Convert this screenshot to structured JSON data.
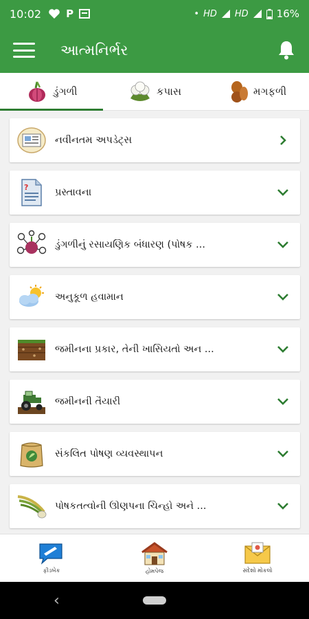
{
  "status_bar": {
    "time": "10:02",
    "signal_1": "HD",
    "signal_2": "HD",
    "battery": "16%"
  },
  "app_bar": {
    "title": "આત્મનિર્ભર"
  },
  "tabs": [
    {
      "label": "ડુંગળી",
      "icon": "onion-icon",
      "active": true
    },
    {
      "label": "કપાસ",
      "icon": "cotton-icon",
      "active": false
    },
    {
      "label": "મગફળી",
      "icon": "peanut-icon",
      "active": false
    }
  ],
  "list": [
    {
      "label": "નવીનતમ અપડેટ્સ",
      "icon": "newspaper-icon",
      "chevron": "right"
    },
    {
      "label": "પ્રસ્તાવના",
      "icon": "document-icon",
      "chevron": "down"
    },
    {
      "label": "ડુંગળીનું રસાયણિક બંધારણ (પોષક ...",
      "icon": "onion-nutrients-icon",
      "chevron": "down"
    },
    {
      "label": "અનુકૂળ હવામાન",
      "icon": "weather-icon",
      "chevron": "down"
    },
    {
      "label": "જમીનના પ્રકાર, તેની ખાસિયતો અન ...",
      "icon": "soil-icon",
      "chevron": "down"
    },
    {
      "label": "જમીનની તૈયારી",
      "icon": "tractor-icon",
      "chevron": "down"
    },
    {
      "label": "સંકલિત પોષણ વ્યવસ્થાપન",
      "icon": "fertilizer-bag-icon",
      "chevron": "down"
    },
    {
      "label": "પોષકતત્વોની ઊણપના ચિન્હો અને ...",
      "icon": "onion-leaves-icon",
      "chevron": "down"
    }
  ],
  "bottom_nav": [
    {
      "label": "ફીડબેક",
      "icon": "feedback-icon"
    },
    {
      "label": "હોમપેજ",
      "icon": "home-icon"
    },
    {
      "label": "સંદેશો મોકલો",
      "icon": "mail-icon"
    }
  ],
  "colors": {
    "primary": "#3c9a43",
    "indicator": "#2e7d32",
    "chevron": "#2e7d32"
  }
}
